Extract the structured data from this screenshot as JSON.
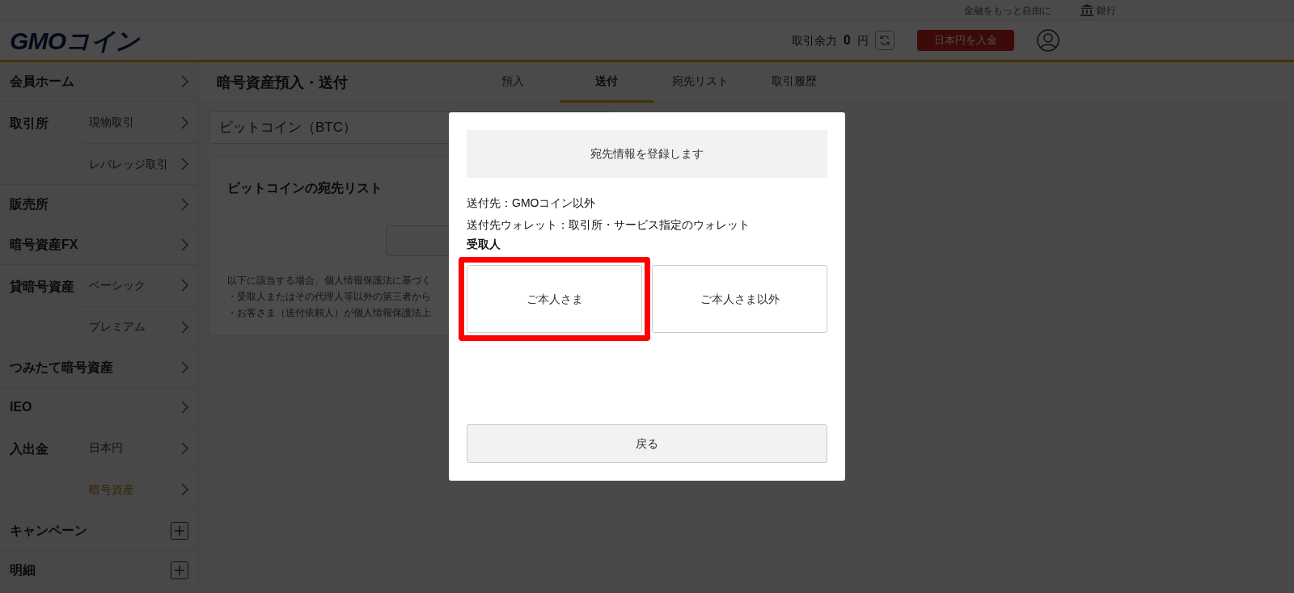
{
  "top_bar": {
    "tagline": "金融をもっと自由に",
    "bank_link": "銀行"
  },
  "header": {
    "logo": "GMOコイン",
    "balance_label": "取引余力",
    "balance_value": "0",
    "balance_unit": "円",
    "deposit_button": "日本円を入金"
  },
  "sidebar": {
    "items": [
      {
        "label": "会員ホーム",
        "kind": "link"
      },
      {
        "label": "取引所",
        "kind": "group",
        "children": [
          {
            "label": "現物取引",
            "selected": false
          },
          {
            "label": "レバレッジ取引",
            "selected": false
          }
        ]
      },
      {
        "label": "販売所",
        "kind": "link"
      },
      {
        "label": "暗号資産FX",
        "kind": "link"
      },
      {
        "label": "貸暗号資産",
        "kind": "group",
        "children": [
          {
            "label": "ベーシック",
            "selected": false
          },
          {
            "label": "プレミアム",
            "selected": false
          }
        ]
      },
      {
        "label": "つみたて暗号資産",
        "kind": "link"
      },
      {
        "label": "IEO",
        "kind": "link"
      },
      {
        "label": "入出金",
        "kind": "group",
        "children": [
          {
            "label": "日本円",
            "selected": false
          },
          {
            "label": "暗号資産",
            "selected": true
          }
        ]
      },
      {
        "label": "キャンペーン",
        "kind": "expand"
      },
      {
        "label": "明細",
        "kind": "expand"
      }
    ]
  },
  "page": {
    "title": "暗号資産預入・送付",
    "tabs": [
      {
        "label": "預入",
        "selected": false
      },
      {
        "label": "送付",
        "selected": true
      },
      {
        "label": "宛先リスト",
        "selected": false
      },
      {
        "label": "取引履歴",
        "selected": false
      }
    ],
    "currency_select": {
      "value": "ビットコイン（BTC）"
    },
    "card": {
      "title": "ビットコインの宛先リスト",
      "notes": [
        "以下に該当する場合、個人情報保護法に基づく",
        "・受取人またはその代理人等以外の第三者から",
        "・お客さま（送付依頼人）が個人情報保護法上"
      ]
    }
  },
  "modal": {
    "heading": "宛先情報を登録します",
    "details": [
      "送付先：GMOコイン以外",
      "送付先ウォレット：取引所・サービス指定のウォレット"
    ],
    "recipient": {
      "label": "受取人",
      "options": [
        {
          "label": "ご本人さま",
          "highlighted": true
        },
        {
          "label": "ご本人さま以外",
          "highlighted": false
        }
      ]
    },
    "back_button": "戻る"
  }
}
